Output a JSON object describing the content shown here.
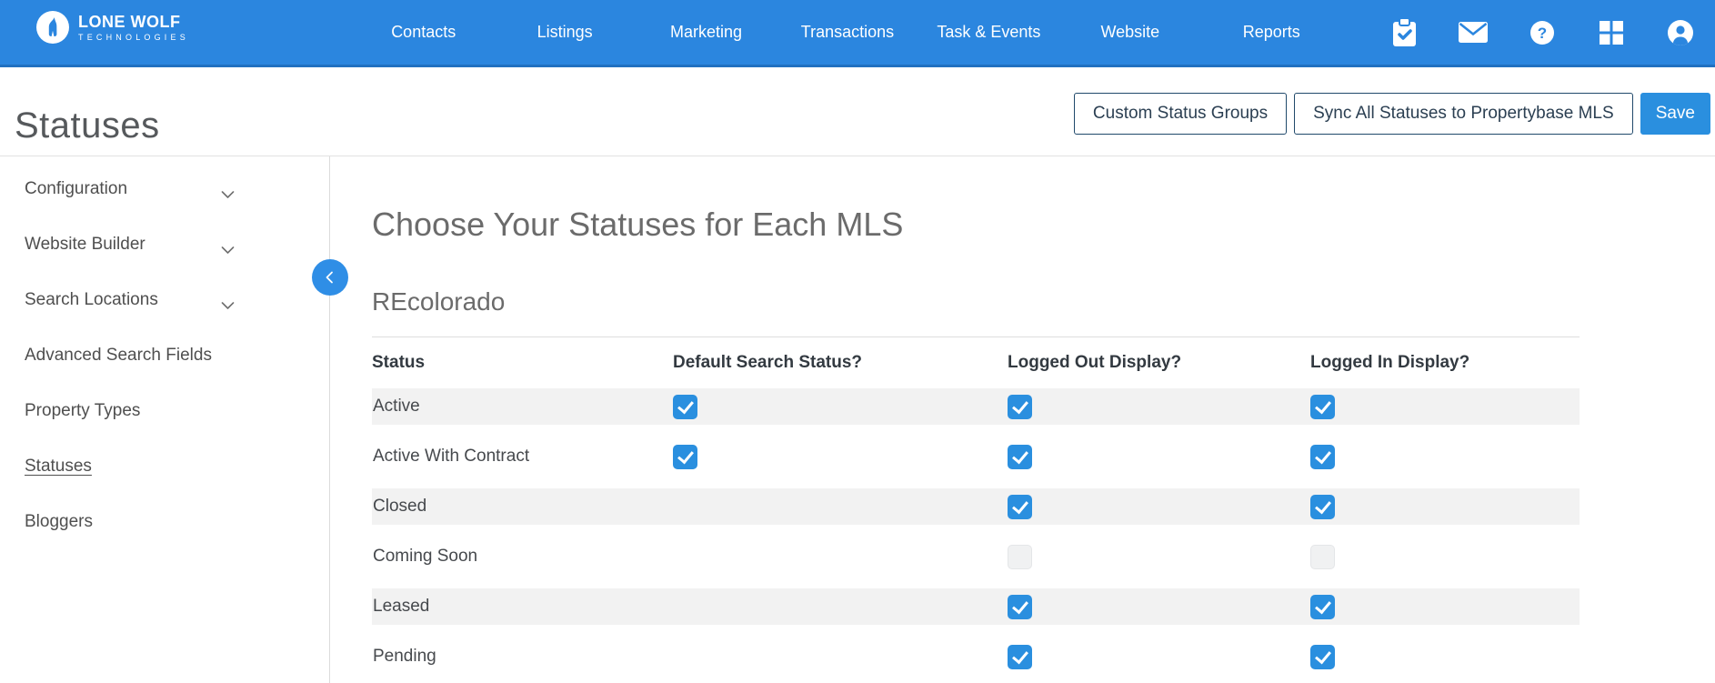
{
  "colors": {
    "navbar_blue": "#2b86df",
    "navbar_edge": "#2170c0",
    "accent_blue": "#2a8fdf",
    "stripe_gray": "#f2f2f2",
    "heading_gray": "#6b6b6b",
    "outline_button_border": "#20496b"
  },
  "nav": {
    "brand": {
      "line1": "LONE WOLF",
      "line2": "TECHNOLOGIES"
    },
    "items": [
      "Contacts",
      "Listings",
      "Marketing",
      "Transactions",
      "Task & Events",
      "Website",
      "Reports"
    ],
    "action_icons": [
      "tasks-clipboard-icon",
      "mail-envelope-icon",
      "help-icon",
      "apps-grid-icon",
      "account-icon"
    ]
  },
  "header": {
    "title": "Statuses",
    "actions": [
      {
        "label": "Custom Status Groups",
        "style": "outline"
      },
      {
        "label": "Sync All Statuses to Propertybase MLS",
        "style": "outline"
      },
      {
        "label": "Save",
        "style": "primary"
      }
    ]
  },
  "sidebar": {
    "items": [
      {
        "label": "Configuration",
        "expandable": true,
        "active": false
      },
      {
        "label": "Website Builder",
        "expandable": true,
        "active": false
      },
      {
        "label": "Search Locations",
        "expandable": true,
        "active": false
      },
      {
        "label": "Advanced Search Fields",
        "expandable": false,
        "active": false
      },
      {
        "label": "Property Types",
        "expandable": false,
        "active": false
      },
      {
        "label": "Statuses",
        "expandable": false,
        "active": true
      },
      {
        "label": "Bloggers",
        "expandable": false,
        "active": false
      }
    ]
  },
  "main": {
    "heading": "Choose Your Statuses for Each MLS",
    "mls_name": "REcolorado",
    "table": {
      "columns": [
        "Status",
        "Default Search Status?",
        "Logged Out Display?",
        "Logged In Display?"
      ],
      "rows": [
        {
          "status": "Active",
          "default_search": "checked",
          "logged_out": "checked",
          "logged_in": "checked"
        },
        {
          "status": "Active With Contract",
          "default_search": "checked",
          "logged_out": "checked",
          "logged_in": "checked"
        },
        {
          "status": "Closed",
          "default_search": "none",
          "logged_out": "checked",
          "logged_in": "checked"
        },
        {
          "status": "Coming Soon",
          "default_search": "none",
          "logged_out": "unchecked",
          "logged_in": "unchecked"
        },
        {
          "status": "Leased",
          "default_search": "none",
          "logged_out": "checked",
          "logged_in": "checked"
        },
        {
          "status": "Pending",
          "default_search": "none",
          "logged_out": "checked",
          "logged_in": "checked"
        }
      ]
    }
  }
}
